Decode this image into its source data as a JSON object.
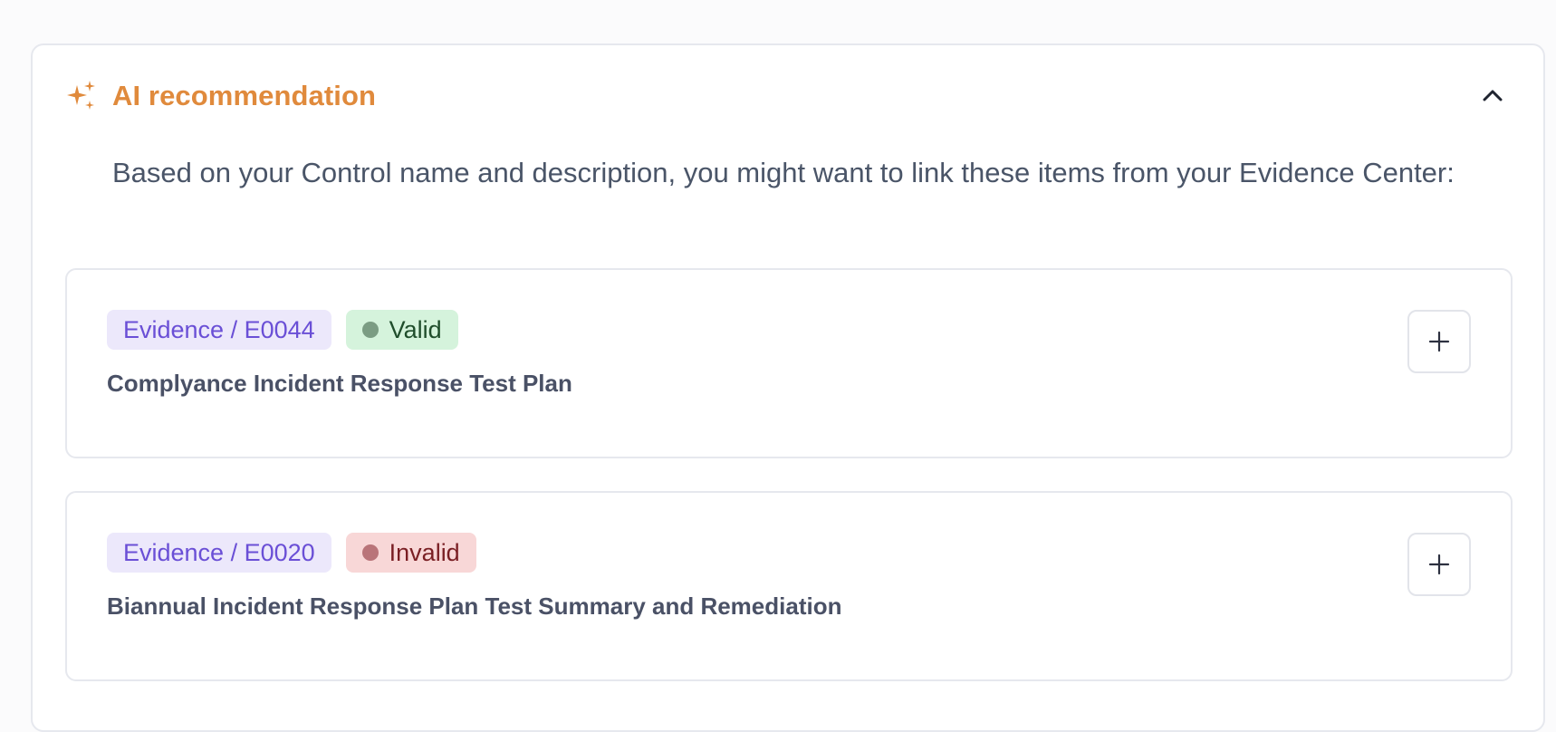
{
  "recommendation": {
    "title": "AI recommendation",
    "description": "Based on your Control name and description, you might want to link these items from your Evidence Center:",
    "icon": "sparkle-icon",
    "collapse_icon": "chevron-up-icon",
    "accent_color": "#e08a3c"
  },
  "items": [
    {
      "evidence_label": "Evidence / E0044",
      "status": "Valid",
      "status_color": "#d5f3dc",
      "title": "Complyance Incident Response Test Plan",
      "action_icon": "plus-icon"
    },
    {
      "evidence_label": "Evidence / E0020",
      "status": "Invalid",
      "status_color": "#f8d7d7",
      "title": "Biannual Incident Response Plan Test Summary and Remediation",
      "action_icon": "plus-icon"
    }
  ]
}
